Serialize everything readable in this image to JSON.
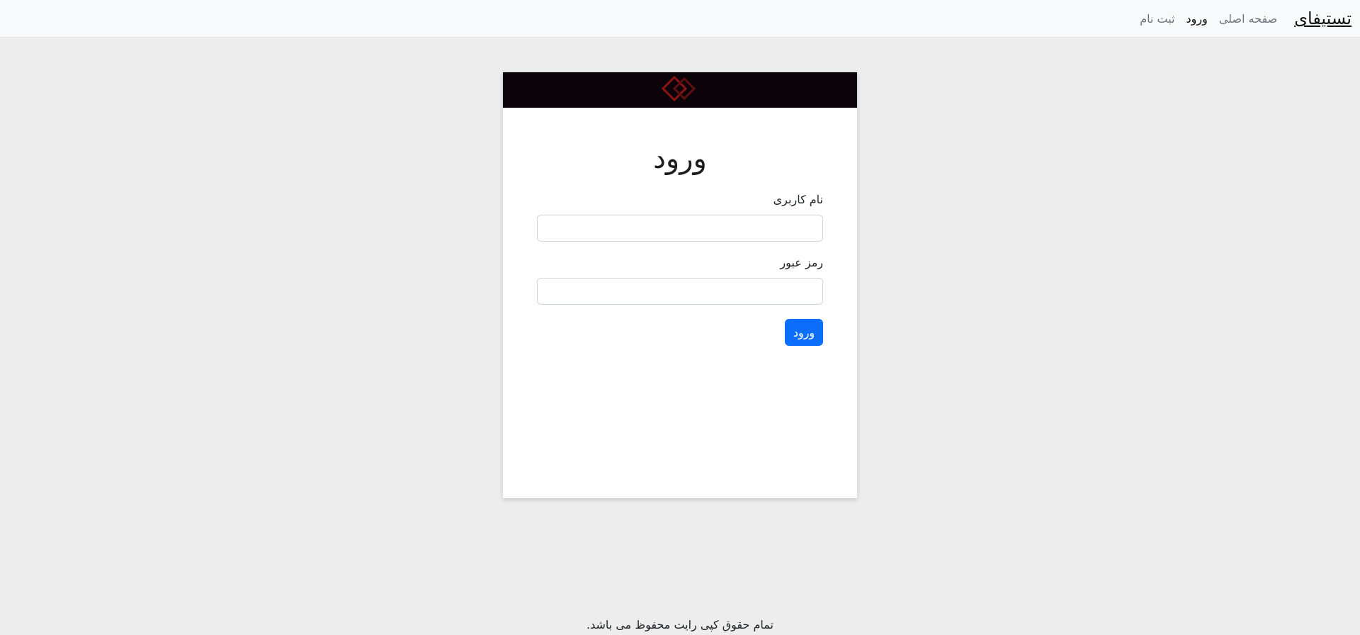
{
  "navbar": {
    "brand": "تستیفای",
    "links": [
      {
        "label": "صفحه اصلی",
        "active": false
      },
      {
        "label": "ورود",
        "active": true
      },
      {
        "label": "ثبت نام",
        "active": false
      }
    ]
  },
  "card": {
    "logo_icon": "diamond-logo-icon",
    "logo_color": "#8b1414",
    "header_color": "#0b020a",
    "title": "ورود",
    "username_label": "نام کاربری",
    "username_value": "",
    "password_label": "رمز عبور",
    "password_value": "",
    "submit_label": "ورود",
    "accent_color": "#0d6efd"
  },
  "footer": {
    "copyright": "تمام حقوق کپی رایت محفوظ می باشد."
  }
}
